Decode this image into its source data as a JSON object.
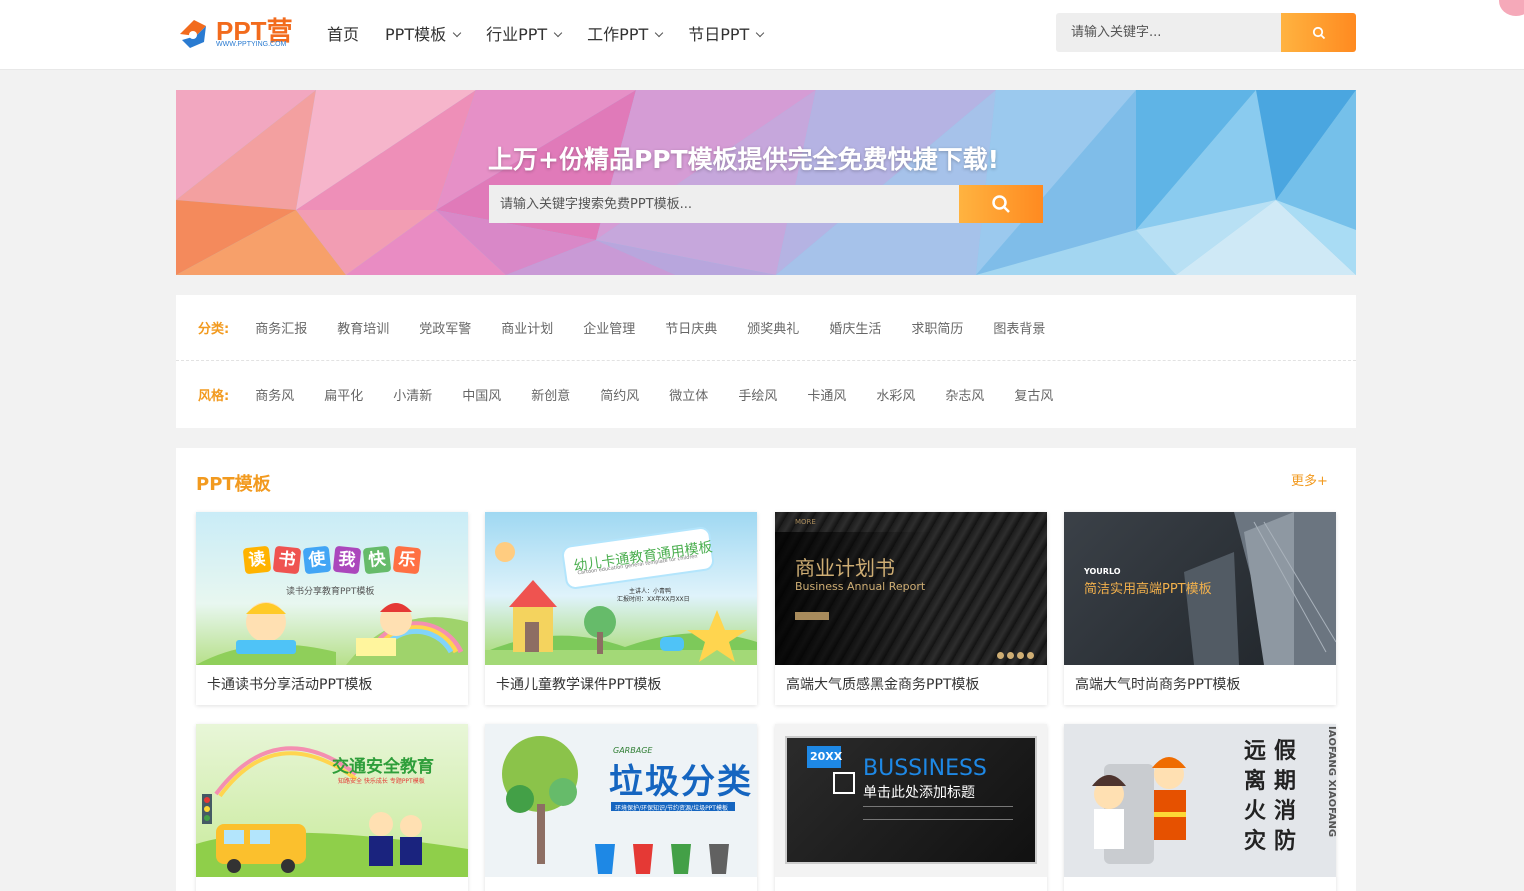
{
  "header": {
    "logo_text": "PPT营",
    "logo_sub": "WWW.PPTYING.COM",
    "nav": [
      {
        "label": "首页",
        "dropdown": false
      },
      {
        "label": "PPT模板",
        "dropdown": true
      },
      {
        "label": "行业PPT",
        "dropdown": true
      },
      {
        "label": "工作PPT",
        "dropdown": true
      },
      {
        "label": "节日PPT",
        "dropdown": true
      }
    ],
    "search_placeholder": "请输入关键字...",
    "search_icon": "search-icon"
  },
  "banner": {
    "title": "上万+份精品PPT模板提供完全免费快捷下载!",
    "search_placeholder": "请输入关键字搜索免费PPT模板...",
    "search_icon": "search-icon"
  },
  "filters": {
    "category": {
      "label": "分类:",
      "items": [
        "商务汇报",
        "教育培训",
        "党政军警",
        "商业计划",
        "企业管理",
        "节日庆典",
        "颁奖典礼",
        "婚庆生活",
        "求职简历",
        "图表背景"
      ]
    },
    "style": {
      "label": "风格:",
      "items": [
        "商务风",
        "扁平化",
        "小清新",
        "中国风",
        "新创意",
        "简约风",
        "微立体",
        "手绘风",
        "卡通风",
        "水彩风",
        "杂志风",
        "复古风"
      ]
    }
  },
  "templates": {
    "title": "PPT模板",
    "more": "更多+",
    "cards": [
      {
        "caption": "卡通读书分享活动PPT模板",
        "thumb_text": [
          "读",
          "书",
          "使",
          "我",
          "快",
          "乐"
        ],
        "thumb_sub": "读书分享教育PPT模板"
      },
      {
        "caption": "卡通儿童教学课件PPT模板",
        "thumb_text": "幼儿卡通教育通用模板",
        "thumb_sub": "Cartoon education general template for children",
        "thumb_sub2": "主讲人：小青鸭",
        "thumb_sub3": "汇报时间：XX年XX月XX日"
      },
      {
        "caption": "高端大气质感黑金商务PPT模板",
        "thumb_text": "商业计划书",
        "thumb_sub": "Business Annual Report",
        "thumb_more": "MORE"
      },
      {
        "caption": "高端大气时尚商务PPT模板",
        "thumb_text": "简洁实用高端PPT模板",
        "thumb_sub": "YOURLO"
      },
      {
        "caption": "",
        "thumb_text": "交通安全教育",
        "thumb_sub": "知路安全 快乐成长  专题PPT模板"
      },
      {
        "caption": "",
        "thumb_text": "垃圾分类",
        "thumb_sub": "GARBAGE",
        "thumb_sub2": "环境保护/环保知识/节约资源/垃圾PPT模板"
      },
      {
        "caption": "",
        "thumb_text": "BUSSINESS",
        "thumb_sub": "单击此处添加标题",
        "thumb_year": "20XX"
      },
      {
        "caption": "",
        "thumb_text": [
          "远",
          "假",
          "离",
          "期",
          "火",
          "消",
          "灾",
          "防"
        ],
        "thumb_sub": "IAOFANG  XIAOFANG"
      }
    ]
  },
  "colors": {
    "accent": "#f29a1f",
    "button_start": "#ffb340",
    "button_end": "#ff8a20",
    "logo": "#f26b1d"
  }
}
